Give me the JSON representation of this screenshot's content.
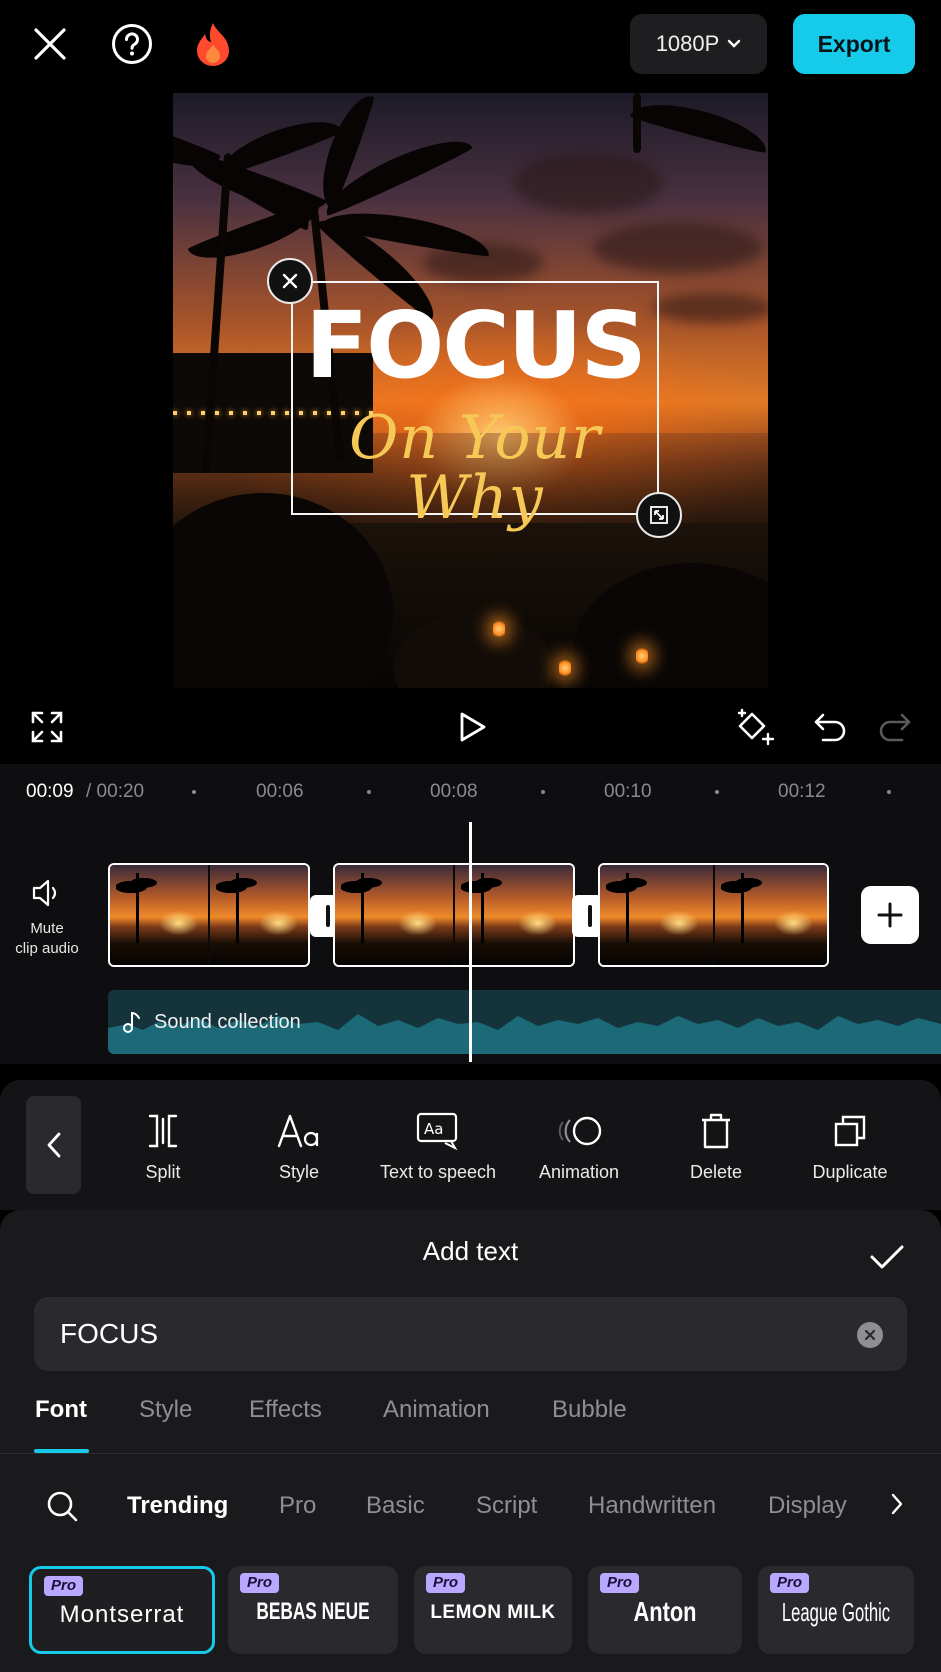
{
  "topbar": {
    "resolution": "1080P",
    "export_label": "Export"
  },
  "preview": {
    "title": "FOCUS",
    "subtitle": "On Your Why"
  },
  "timeline": {
    "current_time": "00:09",
    "total_time": " / 00:20",
    "ticks": [
      "00:06",
      "00:08",
      "00:10",
      "00:12"
    ],
    "mute_label_1": "Mute",
    "mute_label_2": "clip audio",
    "audio_label": "Sound collection"
  },
  "toolbar": {
    "items": [
      {
        "label": "Split",
        "icon": "split-icon"
      },
      {
        "label": "Style",
        "icon": "text-style-icon"
      },
      {
        "label": "Text to speech",
        "icon": "text-to-speech-icon"
      },
      {
        "label": "Animation",
        "icon": "animation-icon"
      },
      {
        "label": "Delete",
        "icon": "trash-icon"
      },
      {
        "label": "Duplicate",
        "icon": "duplicate-icon"
      }
    ]
  },
  "sheet": {
    "title": "Add text",
    "input_value": "FOCUS",
    "tabs": [
      "Font",
      "Style",
      "Effects",
      "Animation",
      "Bubble"
    ],
    "active_tab": "Font",
    "categories": [
      "Trending",
      "Pro",
      "Basic",
      "Script",
      "Handwritten",
      "Display"
    ],
    "active_category": "Trending",
    "fonts": [
      {
        "badge": "Pro",
        "name": "Montserrat",
        "selected": true
      },
      {
        "badge": "Pro",
        "name": "BEBAS NEUE",
        "selected": false
      },
      {
        "badge": "Pro",
        "name": "LEMON MILK",
        "selected": false
      },
      {
        "badge": "Pro",
        "name": "Anton",
        "selected": false
      },
      {
        "badge": "Pro",
        "name": "League Gothic",
        "selected": false
      }
    ]
  },
  "colors": {
    "accent": "#16cbea",
    "background": "#000000",
    "sheet": "#1a1a1d",
    "pro_badge": "#b9a8ff",
    "subtitle_gold": "#f6c957"
  }
}
